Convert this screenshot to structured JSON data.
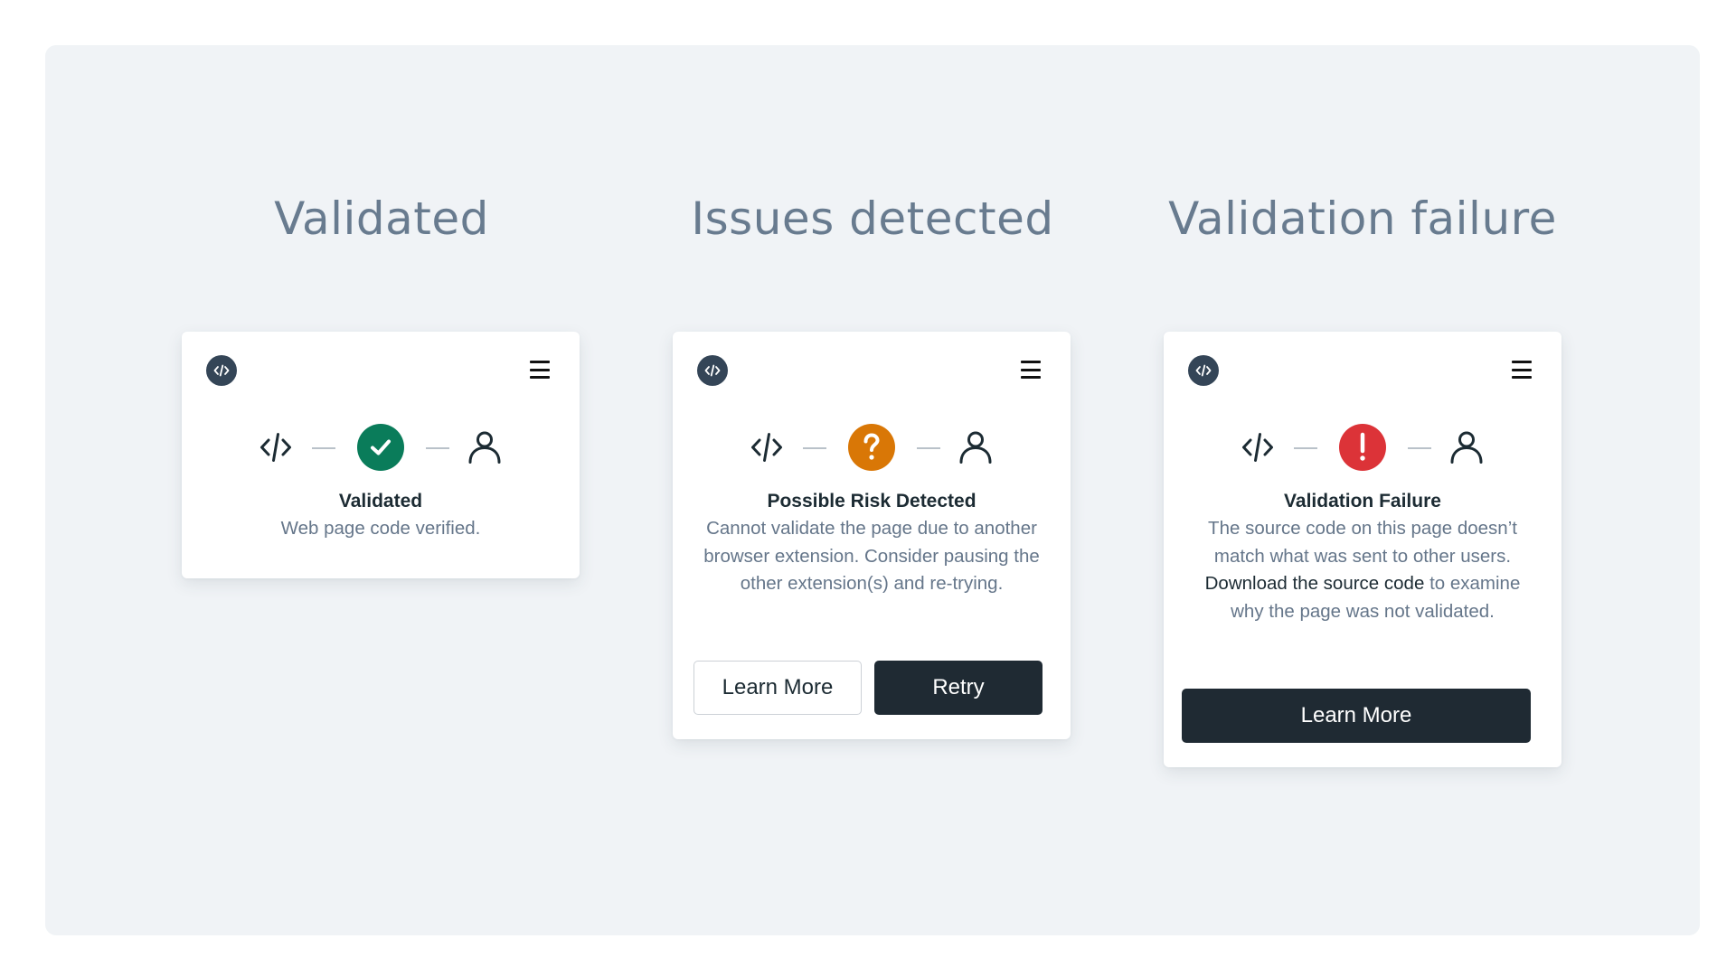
{
  "colors": {
    "panel_bg": "#f0f3f6",
    "heading": "#687b8f",
    "logo_bg": "#344557",
    "success": "#0a7c5a",
    "warning": "#d97706",
    "error": "#dc3338",
    "title_text": "#1c2b33",
    "body_text": "#65768a",
    "button_dark": "#1f2a33"
  },
  "columns": [
    {
      "heading": "Validated",
      "card": {
        "logo_icon": "code-logo-icon",
        "menu_icon": "hamburger-menu-icon",
        "status_flow": {
          "source_icon": "code-icon",
          "status_icon": "checkmark-icon",
          "status": "success",
          "target_icon": "user-icon"
        },
        "title": "Validated",
        "body": "Web page code verified."
      }
    },
    {
      "heading": "Issues detected",
      "card": {
        "logo_icon": "code-logo-icon",
        "menu_icon": "hamburger-menu-icon",
        "status_flow": {
          "source_icon": "code-icon",
          "status_icon": "question-mark-icon",
          "status": "warning",
          "target_icon": "user-icon"
        },
        "title": "Possible Risk Detected",
        "body": "Cannot validate the page due to another browser extension. Consider pausing the other extension(s) and re-trying.",
        "buttons": [
          {
            "label": "Learn More",
            "style": "outline"
          },
          {
            "label": "Retry",
            "style": "primary"
          }
        ]
      }
    },
    {
      "heading": "Validation failure",
      "card": {
        "logo_icon": "code-logo-icon",
        "menu_icon": "hamburger-menu-icon",
        "status_flow": {
          "source_icon": "code-icon",
          "status_icon": "exclamation-icon",
          "status": "error",
          "target_icon": "user-icon"
        },
        "title": "Validation Failure",
        "body_before_link": "The source code on this page doesn’t match what was sent to other users. ",
        "body_link": "Download the source code",
        "body_after_link": " to examine why the page was not validated.",
        "buttons": [
          {
            "label": "Learn More",
            "style": "primary"
          }
        ]
      }
    }
  ]
}
